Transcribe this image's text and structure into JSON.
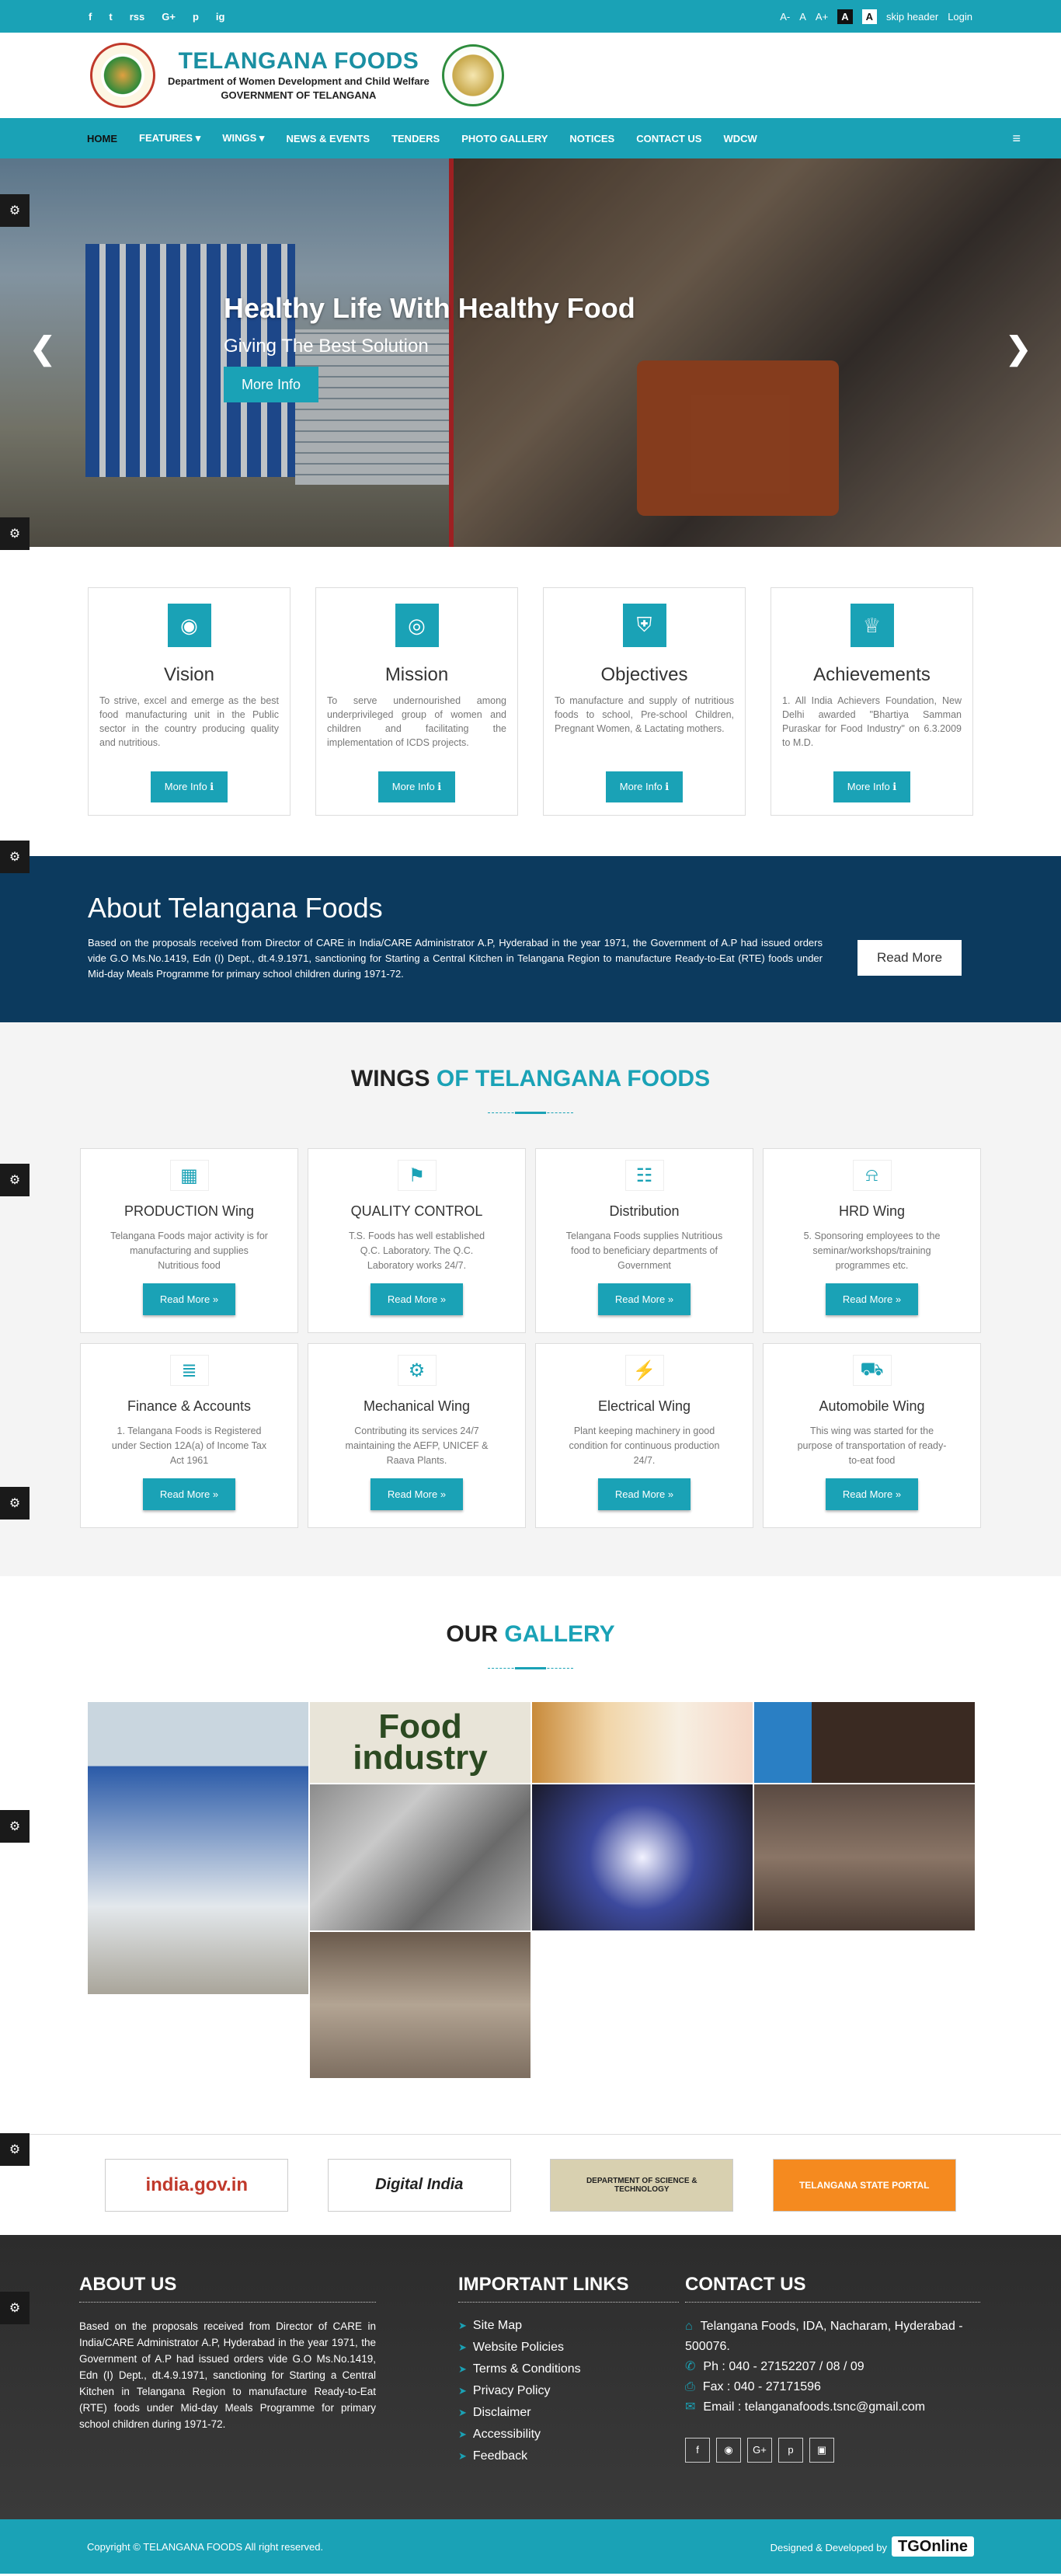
{
  "topbar": {
    "social": [
      "f",
      "t",
      "rss",
      "G+",
      "p",
      "ig"
    ],
    "font_small": "A-",
    "font_normal": "A",
    "font_large": "A+",
    "contrast_dark": "A",
    "contrast_light": "A",
    "skip": "skip header",
    "login": "Login"
  },
  "header": {
    "title": "TELANGANA FOODS",
    "sub1": "Department of Women Development and Child Welfare",
    "sub2": "GOVERNMENT OF TELANGANA"
  },
  "nav": {
    "items": [
      "HOME",
      "FEATURES ▾",
      "WINGS ▾",
      "NEWS & EVENTS",
      "TENDERS",
      "PHOTO GALLERY",
      "NOTICES",
      "CONTACT US",
      "WDCW"
    ],
    "menu_icon": "≡"
  },
  "hero": {
    "title": "Healthy Life With Healthy Food",
    "subtitle": "Giving The Best Solution",
    "button": "More Info",
    "prev": "❮",
    "next": "❯"
  },
  "cards": [
    {
      "icon": "eye-icon",
      "glyph": "◉",
      "title": "Vision",
      "text": "To strive, excel and emerge as the best food manufacturing unit in the Public sector in the country producing quality and nutritious.",
      "button": "More Info ℹ"
    },
    {
      "icon": "target-icon",
      "glyph": "◎",
      "title": "Mission",
      "text": "To serve undernourished among underprivileged group of women and children and facilitating the implementation of ICDS projects.",
      "button": "More Info ℹ"
    },
    {
      "icon": "shield-icon",
      "glyph": "⛨",
      "title": "Objectives",
      "text": "To manufacture and supply of nutritious foods to school, Pre-school Children, Pregnant Women, & Lactating mothers.",
      "button": "More Info ℹ"
    },
    {
      "icon": "trophy-icon",
      "glyph": "♕",
      "title": "Achievements",
      "text": "1. All India Achievers Foundation, New Delhi awarded \"Bhartiya Samman Puraskar for Food Industry\" on 6.3.2009 to M.D.",
      "button": "More Info ℹ"
    }
  ],
  "about": {
    "title": "About Telangana Foods",
    "text": "Based on the proposals received from Director of CARE in India/CARE Administrator A.P, Hyderabad in the year 1971, the Government of A.P had issued orders vide G.O Ms.No.1419, Edn (I) Dept., dt.4.9.1971, sanctioning for Starting a Central Kitchen in Telangana Region to manufacture Ready-to-Eat (RTE) foods under Mid-day Meals Programme for primary school children during 1971-72.",
    "button": "Read More"
  },
  "wings": {
    "title_a": "WINGS ",
    "title_b": "OF TELANGANA FOODS",
    "items": [
      {
        "icon": "grid-icon",
        "glyph": "▦",
        "title": "PRODUCTION Wing",
        "text": "Telangana Foods major activity is for manufacturing and supplies Nutritious food",
        "button": "Read More »"
      },
      {
        "icon": "bookmark-icon",
        "glyph": "⚑",
        "title": "QUALITY CONTROL",
        "text": "T.S. Foods has well established Q.C. Laboratory. The Q.C. Laboratory works 24/7.",
        "button": "Read More »"
      },
      {
        "icon": "sitemap-icon",
        "glyph": "☷",
        "title": "Distribution",
        "text": "Telangana Foods supplies Nutritious food to beneficiary departments of Government",
        "button": "Read More »"
      },
      {
        "icon": "bell-icon",
        "glyph": "⍾",
        "title": "HRD Wing",
        "text": "5. Sponsoring employees to the seminar/workshops/training programmes etc.",
        "button": "Read More »"
      },
      {
        "icon": "document-icon",
        "glyph": "≣",
        "title": "Finance & Accounts",
        "text": "1. Telangana Foods is Registered under Section 12A(a) of Income Tax Act 1961",
        "button": "Read More »"
      },
      {
        "icon": "gears-icon",
        "glyph": "⚙",
        "title": "Mechanical Wing",
        "text": "Contributing its services 24/7 maintaining the AEFP, UNICEF & Raava Plants.",
        "button": "Read More »"
      },
      {
        "icon": "bolt-icon",
        "glyph": "⚡",
        "title": "Electrical Wing",
        "text": "Plant keeping machinery in good condition for continuous production 24/7.",
        "button": "Read More »"
      },
      {
        "icon": "car-icon",
        "glyph": "⛟",
        "title": "Automobile Wing",
        "text": "This wing was started for the purpose of transportation of ready-to-eat food",
        "button": "Read More »"
      }
    ]
  },
  "gallery": {
    "title_a": "OUR ",
    "title_b": "GALLERY",
    "food_industry": "Food industry"
  },
  "logos": [
    "india.gov.in",
    "Digital India",
    "DEPARTMENT OF SCIENCE & TECHNOLOGY",
    "TELANGANA STATE PORTAL"
  ],
  "footer": {
    "about_title": "ABOUT US",
    "about_text": "Based on the proposals received from Director of CARE in India/CARE Administrator A.P, Hyderabad in the year 1971, the Government of A.P had issued orders vide G.O Ms.No.1419, Edn (I) Dept., dt.4.9.1971, sanctioning for Starting a Central Kitchen in Telangana Region to manufacture Ready-to-Eat (RTE) foods under Mid-day Meals Programme for primary school children during 1971-72.",
    "links_title": "IMPORTANT LINKS",
    "links": [
      "Site Map",
      "Website Policies",
      "Terms & Conditions",
      "Privacy Policy",
      "Disclaimer",
      "Accessibility",
      "Feedback"
    ],
    "contact_title": "CONTACT US",
    "address": "Telangana Foods, IDA, Nacharam, Hyderabad - 500076.",
    "phone": "Ph : 040 - 27152207 / 08 / 09",
    "fax": "Fax : 040 - 27171596",
    "email": "Email : telanganafoods.tsnc@gmail.com"
  },
  "copyright": {
    "text": "Copyright © TELANGANA FOODS All right reserved.",
    "designed": "Designed & Developed by",
    "brand": "TGOnline"
  }
}
